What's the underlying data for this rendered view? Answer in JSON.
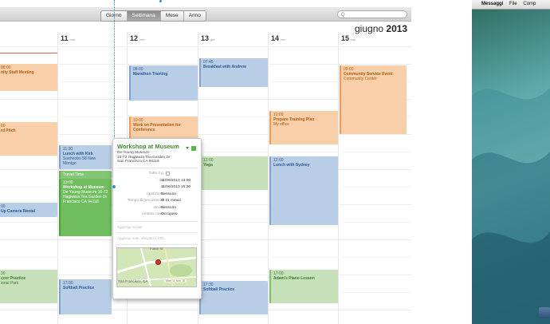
{
  "calendar": {
    "views": [
      "Giorno",
      "Settimana",
      "Mese",
      "Anno"
    ],
    "selected_view": "Settimana",
    "search_placeholder": "Q",
    "month": "giugno",
    "year": "2013",
    "days": [
      {
        "num": "11",
        "wd": "mar"
      },
      {
        "num": "12",
        "wd": "mer"
      },
      {
        "num": "13",
        "wd": "gio"
      },
      {
        "num": "14",
        "wd": "ven"
      },
      {
        "num": "15",
        "wd": "sab"
      }
    ],
    "events": {
      "staff": {
        "time": "08:00",
        "name": "nity Staff Meeting"
      },
      "pitch": {
        "time": "00",
        "name": "rd Pitch"
      },
      "camera": {
        "time": "00",
        "name": "Up Camera Rental"
      },
      "soccer": {
        "time": "30",
        "name": "ccer Practice",
        "loc": "ional Park"
      },
      "kirk": {
        "time": "11:30",
        "name": "Lunch with Kirk",
        "loc": "Suehirobo 58 New Montgo"
      },
      "travel": {
        "label": "Travel Time"
      },
      "workshop": {
        "time": "13:00",
        "name": "Workshop at Museum",
        "loc1": "De Young Museum 16-72",
        "loc2": "Hagiwara Tea Garden Dr",
        "loc3": "Francisco CA 94118"
      },
      "softball1": {
        "time": "17:30",
        "name": "Softball Practice"
      },
      "marathon": {
        "time": "08:00",
        "name": "Marathon Training"
      },
      "presentation": {
        "time": "10:00",
        "name": "Work on Presentation for Conference"
      },
      "breakfast": {
        "time": "07:45",
        "name": "Breakfast with Andrew"
      },
      "yoga": {
        "time": "12:00",
        "name": "Yoga"
      },
      "softball2": {
        "time": "17:30",
        "name": "Softball Practice"
      },
      "training": {
        "time": "10:00",
        "name": "Prepare Training Plan",
        "loc": "My office"
      },
      "sydney": {
        "time": "12:00",
        "name": "Lunch with Sydney"
      },
      "piano": {
        "time": "17:00",
        "name": "Adam's Piano Lesson"
      },
      "community": {
        "time": "09:00",
        "name": "Community Service Event",
        "loc": "Community Center"
      }
    }
  },
  "popover": {
    "title": "Workshop at Museum",
    "address1": "De Young Museum",
    "address2": "16-72 Hagiwara Tea Garden Dr",
    "address3": "San Francisco CA 94118",
    "allday_label": "Tutto il g.",
    "from_label": "dal",
    "from_value": "11/06/2013 13:00",
    "to_label": "al",
    "to_value": "11/06/2013 15:30",
    "repeat_label": "ripetizione",
    "repeat_value": "Nessuno",
    "travel_label": "Tempo di percorrenza",
    "travel_value": "21 minuti",
    "alert_label": "avviso",
    "alert_value": "Nessuno",
    "show_as_label": "mostra come",
    "show_as_value": "Occupato",
    "invitees_placeholder": "Aggiungi invitati",
    "notes_placeholder": "Aggiungi note, allegato o URL",
    "map_street": "Fulton St",
    "map_city": "San Francisco, CA",
    "map_note": "Mon 11 Nov 15"
  },
  "desktop": {
    "menu_app": "Messaggi",
    "menu_items": [
      "File",
      "Comp"
    ]
  },
  "colors": {
    "blue_event": "#b8cde6",
    "orange_event": "#f8cfa8",
    "green_event": "#c6e0b9",
    "green_selected": "#6fbd5f",
    "today_line": "#e05a4f",
    "callout": "#2b95c9"
  }
}
